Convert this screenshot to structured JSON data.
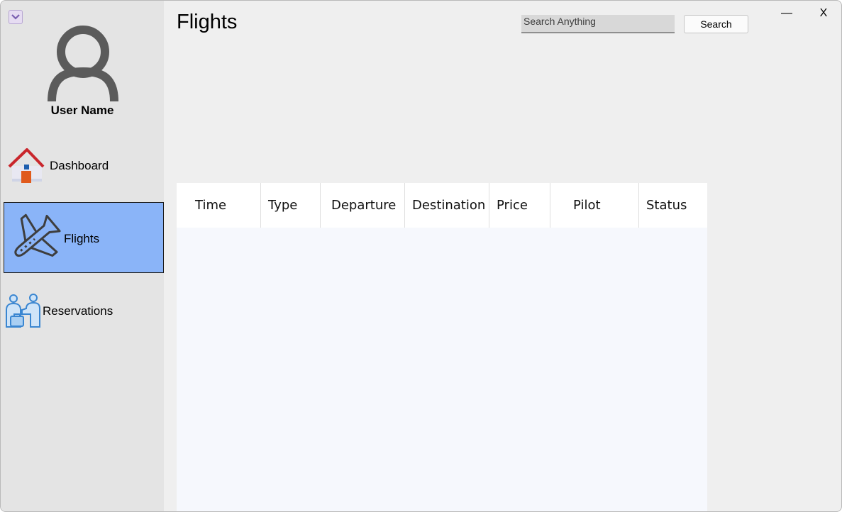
{
  "app": {
    "title": "Flights"
  },
  "sidebar": {
    "user_name": "User Name",
    "items": [
      {
        "label": "Dashboard",
        "icon": "house-icon",
        "active": false
      },
      {
        "label": "Flights",
        "icon": "airplane-icon",
        "active": true
      },
      {
        "label": "Reservations",
        "icon": "reservations-icon",
        "active": false
      }
    ],
    "active_color": "#8ab4f8"
  },
  "header": {
    "search_placeholder": "Search Anything",
    "search_button": "Search"
  },
  "window_controls": {
    "minimize": "—",
    "close": "X"
  },
  "table": {
    "columns": [
      "Time",
      "Type",
      "Departure",
      "Destination",
      "Price",
      "Pilot",
      "Status"
    ],
    "rows": []
  }
}
